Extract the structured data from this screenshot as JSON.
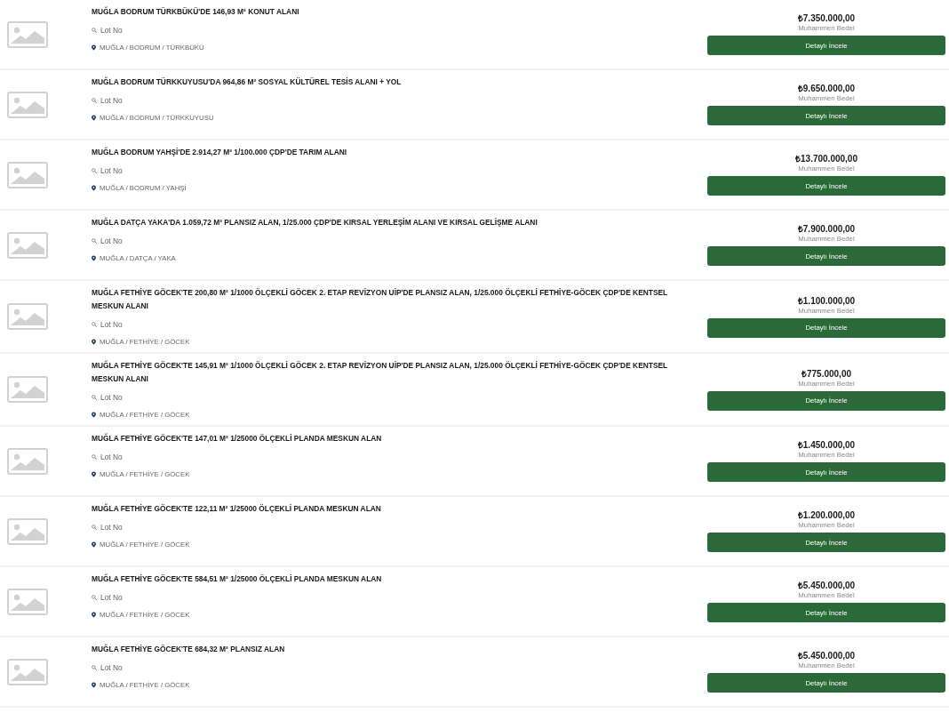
{
  "listings": [
    {
      "title": "MUĞLA BODRUM TÜRKBÜKÜ'DE 146,93 M² KONUT ALANI",
      "lot_label": "Lot No",
      "location": "MUĞLA / BODRUM / TÜRKBÜKÜ",
      "price": "₺7.350.000,00",
      "price_label": "Muhammen Bedel",
      "button": "Detaylı İncele"
    },
    {
      "title": "MUĞLA BODRUM TÜRKKUYUSU'DA 964,86 M² SOSYAL KÜLTÜREL TESİS ALANI + YOL",
      "lot_label": "Lot No",
      "location": "MUĞLA / BODRUM / TÜRKKUYUSU",
      "price": "₺9.650.000,00",
      "price_label": "Muhammen Bedel",
      "button": "Detaylı İncele"
    },
    {
      "title": "MUĞLA BODRUM YAHŞİ'DE 2.914,27 M² 1/100.000 ÇDP'DE TARIM ALANI",
      "lot_label": "Lot No",
      "location": "MUĞLA / BODRUM / YAHŞİ",
      "price": "₺13.700.000,00",
      "price_label": "Muhammen Bedel",
      "button": "Detaylı İncele"
    },
    {
      "title": "MUĞLA DATÇA YAKA'DA 1.059,72 M² PLANSIZ ALAN, 1/25.000 ÇDP'DE KIRSAL YERLEŞİM ALANI VE KIRSAL GELİŞME ALANI",
      "lot_label": "Lot No",
      "location": "MUĞLA / DATÇA / YAKA",
      "price": "₺7.900.000,00",
      "price_label": "Muhammen Bedel",
      "button": "Detaylı İncele"
    },
    {
      "title": "MUĞLA FETHİYE GÖCEK'TE 200,80 M² 1/1000 ÖLÇEKLİ GÖCEK 2. ETAP REVİZYON UİP'DE PLANSIZ ALAN, 1/25.000 ÖLÇEKLİ FETHİYE-GÖCEK ÇDP'DE KENTSEL MESKUN ALANI",
      "lot_label": "Lot No",
      "location": "MUĞLA / FETHİYE / GÖCEK",
      "price": "₺1.100.000,00",
      "price_label": "Muhammen Bedel",
      "button": "Detaylı İncele"
    },
    {
      "title": "MUĞLA FETHİYE GÖCEK'TE 145,91 M² 1/1000 ÖLÇEKLİ GÖCEK 2. ETAP REVİZYON UİP'DE PLANSIZ ALAN, 1/25.000 ÖLÇEKLİ FETHİYE-GÖCEK ÇDP'DE KENTSEL MESKUN ALANI",
      "lot_label": "Lot No",
      "location": "MUĞLA / FETHİYE / GÖCEK",
      "price": "₺775.000,00",
      "price_label": "Muhammen Bedel",
      "button": "Detaylı İncele"
    },
    {
      "title": "MUĞLA FETHİYE GÖCEK'TE 147,01 M² 1/25000 ÖLÇEKLİ PLANDA MESKUN ALAN",
      "lot_label": "Lot No",
      "location": "MUĞLA / FETHİYE / GÖCEK",
      "price": "₺1.450.000,00",
      "price_label": "Muhammen Bedel",
      "button": "Detaylı İncele"
    },
    {
      "title": "MUĞLA FETHİYE GÖCEK'TE 122,11 M² 1/25000 ÖLÇEKLİ PLANDA MESKUN ALAN",
      "lot_label": "Lot No",
      "location": "MUĞLA / FETHİYE / GÖCEK",
      "price": "₺1.200.000,00",
      "price_label": "Muhammen Bedel",
      "button": "Detaylı İncele"
    },
    {
      "title": "MUĞLA FETHİYE GÖCEK'TE 584,51 M² 1/25000 ÖLÇEKLİ PLANDA MESKUN ALAN",
      "lot_label": "Lot No",
      "location": "MUĞLA / FETHİYE / GÖCEK",
      "price": "₺5.450.000,00",
      "price_label": "Muhammen Bedel",
      "button": "Detaylı İncele"
    },
    {
      "title": "MUĞLA FETHİYE GÖCEK'TE 684,32 M² PLANSIZ ALAN",
      "lot_label": "Lot No",
      "location": "MUĞLA / FETHİYE / GÖCEK",
      "price": "₺5.450.000,00",
      "price_label": "Muhammen Bedel",
      "button": "Detaylı İncele"
    }
  ]
}
